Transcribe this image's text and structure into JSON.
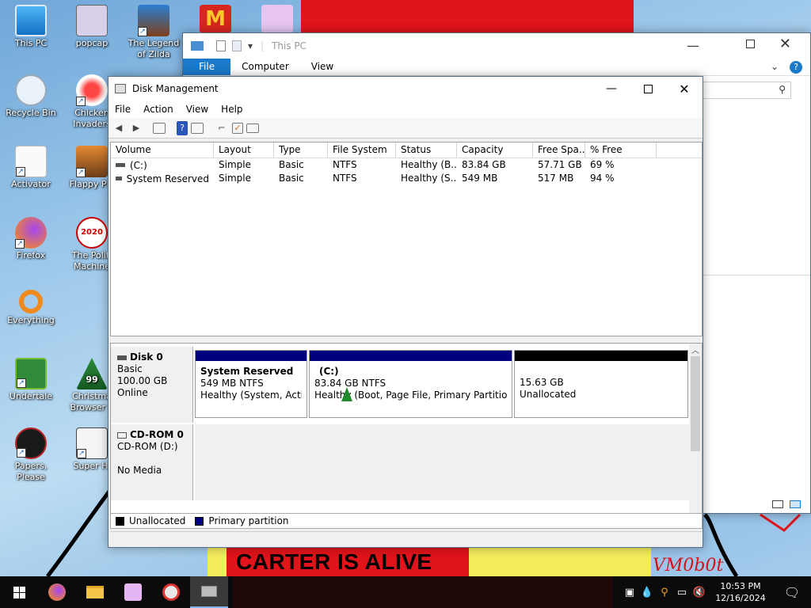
{
  "desktop": {
    "icons": [
      {
        "label": "This PC"
      },
      {
        "label": "popcap"
      },
      {
        "label": "The Legend of Zilda"
      },
      {
        "label": "Recycle Bin"
      },
      {
        "label": "Chicken Invaders"
      },
      {
        "label": "Activator"
      },
      {
        "label": "Flappy Pla"
      },
      {
        "label": "Firefox"
      },
      {
        "label": "The Politi Machine"
      },
      {
        "label": "Everything"
      },
      {
        "label": "Undertale"
      },
      {
        "label": "Christma Browser S"
      },
      {
        "label": "Papers, Please"
      },
      {
        "label": "Super Hi"
      }
    ],
    "banner_text": "CARTER IS ALIVE",
    "signature": "VM0b0t",
    "badge_2020": "2020",
    "badge_99": "99"
  },
  "explorer": {
    "title": "This PC",
    "tabs": [
      "File",
      "Computer",
      "View"
    ]
  },
  "disk_mgmt": {
    "title": "Disk Management",
    "menu": [
      "File",
      "Action",
      "View",
      "Help"
    ],
    "columns": [
      "Volume",
      "Layout",
      "Type",
      "File System",
      "Status",
      "Capacity",
      "Free Spa...",
      "% Free"
    ],
    "volumes": [
      {
        "volume": "(C:)",
        "layout": "Simple",
        "type": "Basic",
        "fs": "NTFS",
        "status": "Healthy (B...",
        "capacity": "83.84 GB",
        "free": "57.71 GB",
        "pct": "69 %"
      },
      {
        "volume": "System Reserved",
        "layout": "Simple",
        "type": "Basic",
        "fs": "NTFS",
        "status": "Healthy (S...",
        "capacity": "549 MB",
        "free": "517 MB",
        "pct": "94 %"
      }
    ],
    "disk0": {
      "name": "Disk 0",
      "type": "Basic",
      "size": "100.00 GB",
      "state": "Online"
    },
    "cdrom0": {
      "name": "CD-ROM 0",
      "drive": "CD-ROM (D:)",
      "media": "No Media"
    },
    "partitions": [
      {
        "name": "System Reserved",
        "size": "549 MB NTFS",
        "status": "Healthy (System, Active,"
      },
      {
        "name": "(C:)",
        "size": "83.84 GB NTFS",
        "status": "Healthy (Boot, Page File, Primary Partition)"
      },
      {
        "name": "",
        "size": "15.63 GB",
        "status": "Unallocated"
      }
    ],
    "legend": [
      "Unallocated",
      "Primary partition"
    ],
    "colors": {
      "primary": "#00007f",
      "unallocated": "#000000"
    }
  },
  "taskbar": {
    "time": "10:53 PM",
    "date": "12/16/2024"
  }
}
